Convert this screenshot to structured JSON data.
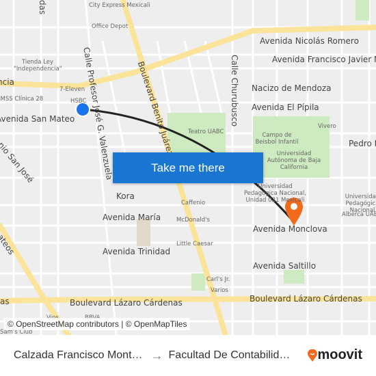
{
  "map": {
    "street_labels": [
      "Avenida Nicolás Romero",
      "Avenida Francisco Javier M",
      "Nacizo de Mendoza",
      "Avenida El Pípila",
      "Avenida San Mateo",
      "Calle Profesor José G. Valenzuela",
      "Boulevard Benito Juárez",
      "Calle Churubusco",
      "Pedro M",
      "Kora",
      "Avenida María",
      "Avenida Trinidad",
      "Avenida Monclova",
      "Avenida Saltillo",
      "Boulevard Lázaro Cárdenas",
      "Boulevard Lázaro Cárdenas",
      "ncia",
      "das",
      "nio San José",
      "ateos",
      "as"
    ],
    "poi_labels": [
      "City Express Mexicali",
      "Office Depot",
      "Tienda Ley \"Independencia\"",
      "7-Eleven",
      "IMSS Clínica 28",
      "HSBC",
      "Teatro UABC",
      "Campo de Beisbol Infantil",
      "Vivero",
      "Universidad Autónoma de Baja California",
      "Universidad Pedagógica Nacional, Unidad 021 Mexicali",
      "Universidad Pedagógica Nacional",
      "Alberca UABC",
      "Caffenio",
      "McDonald's",
      "Little Caesar",
      "Carl's Jr.",
      "Varios",
      "Vips",
      "BBVA",
      "Sam's Club"
    ],
    "colors": {
      "road_major": "#fbe49a",
      "route": "#222222",
      "origin": "#1a73e8",
      "destination": "#f26b1d",
      "park": "#cdeac0"
    }
  },
  "cta_label": "Take me there",
  "attribution": "© OpenStreetMap contributors | © OpenMapTiles",
  "footer": {
    "origin": "Calzada Francisco Mont…",
    "arrow": "→",
    "destination": "Facultad De Contabilid…",
    "brand": "moovit"
  }
}
